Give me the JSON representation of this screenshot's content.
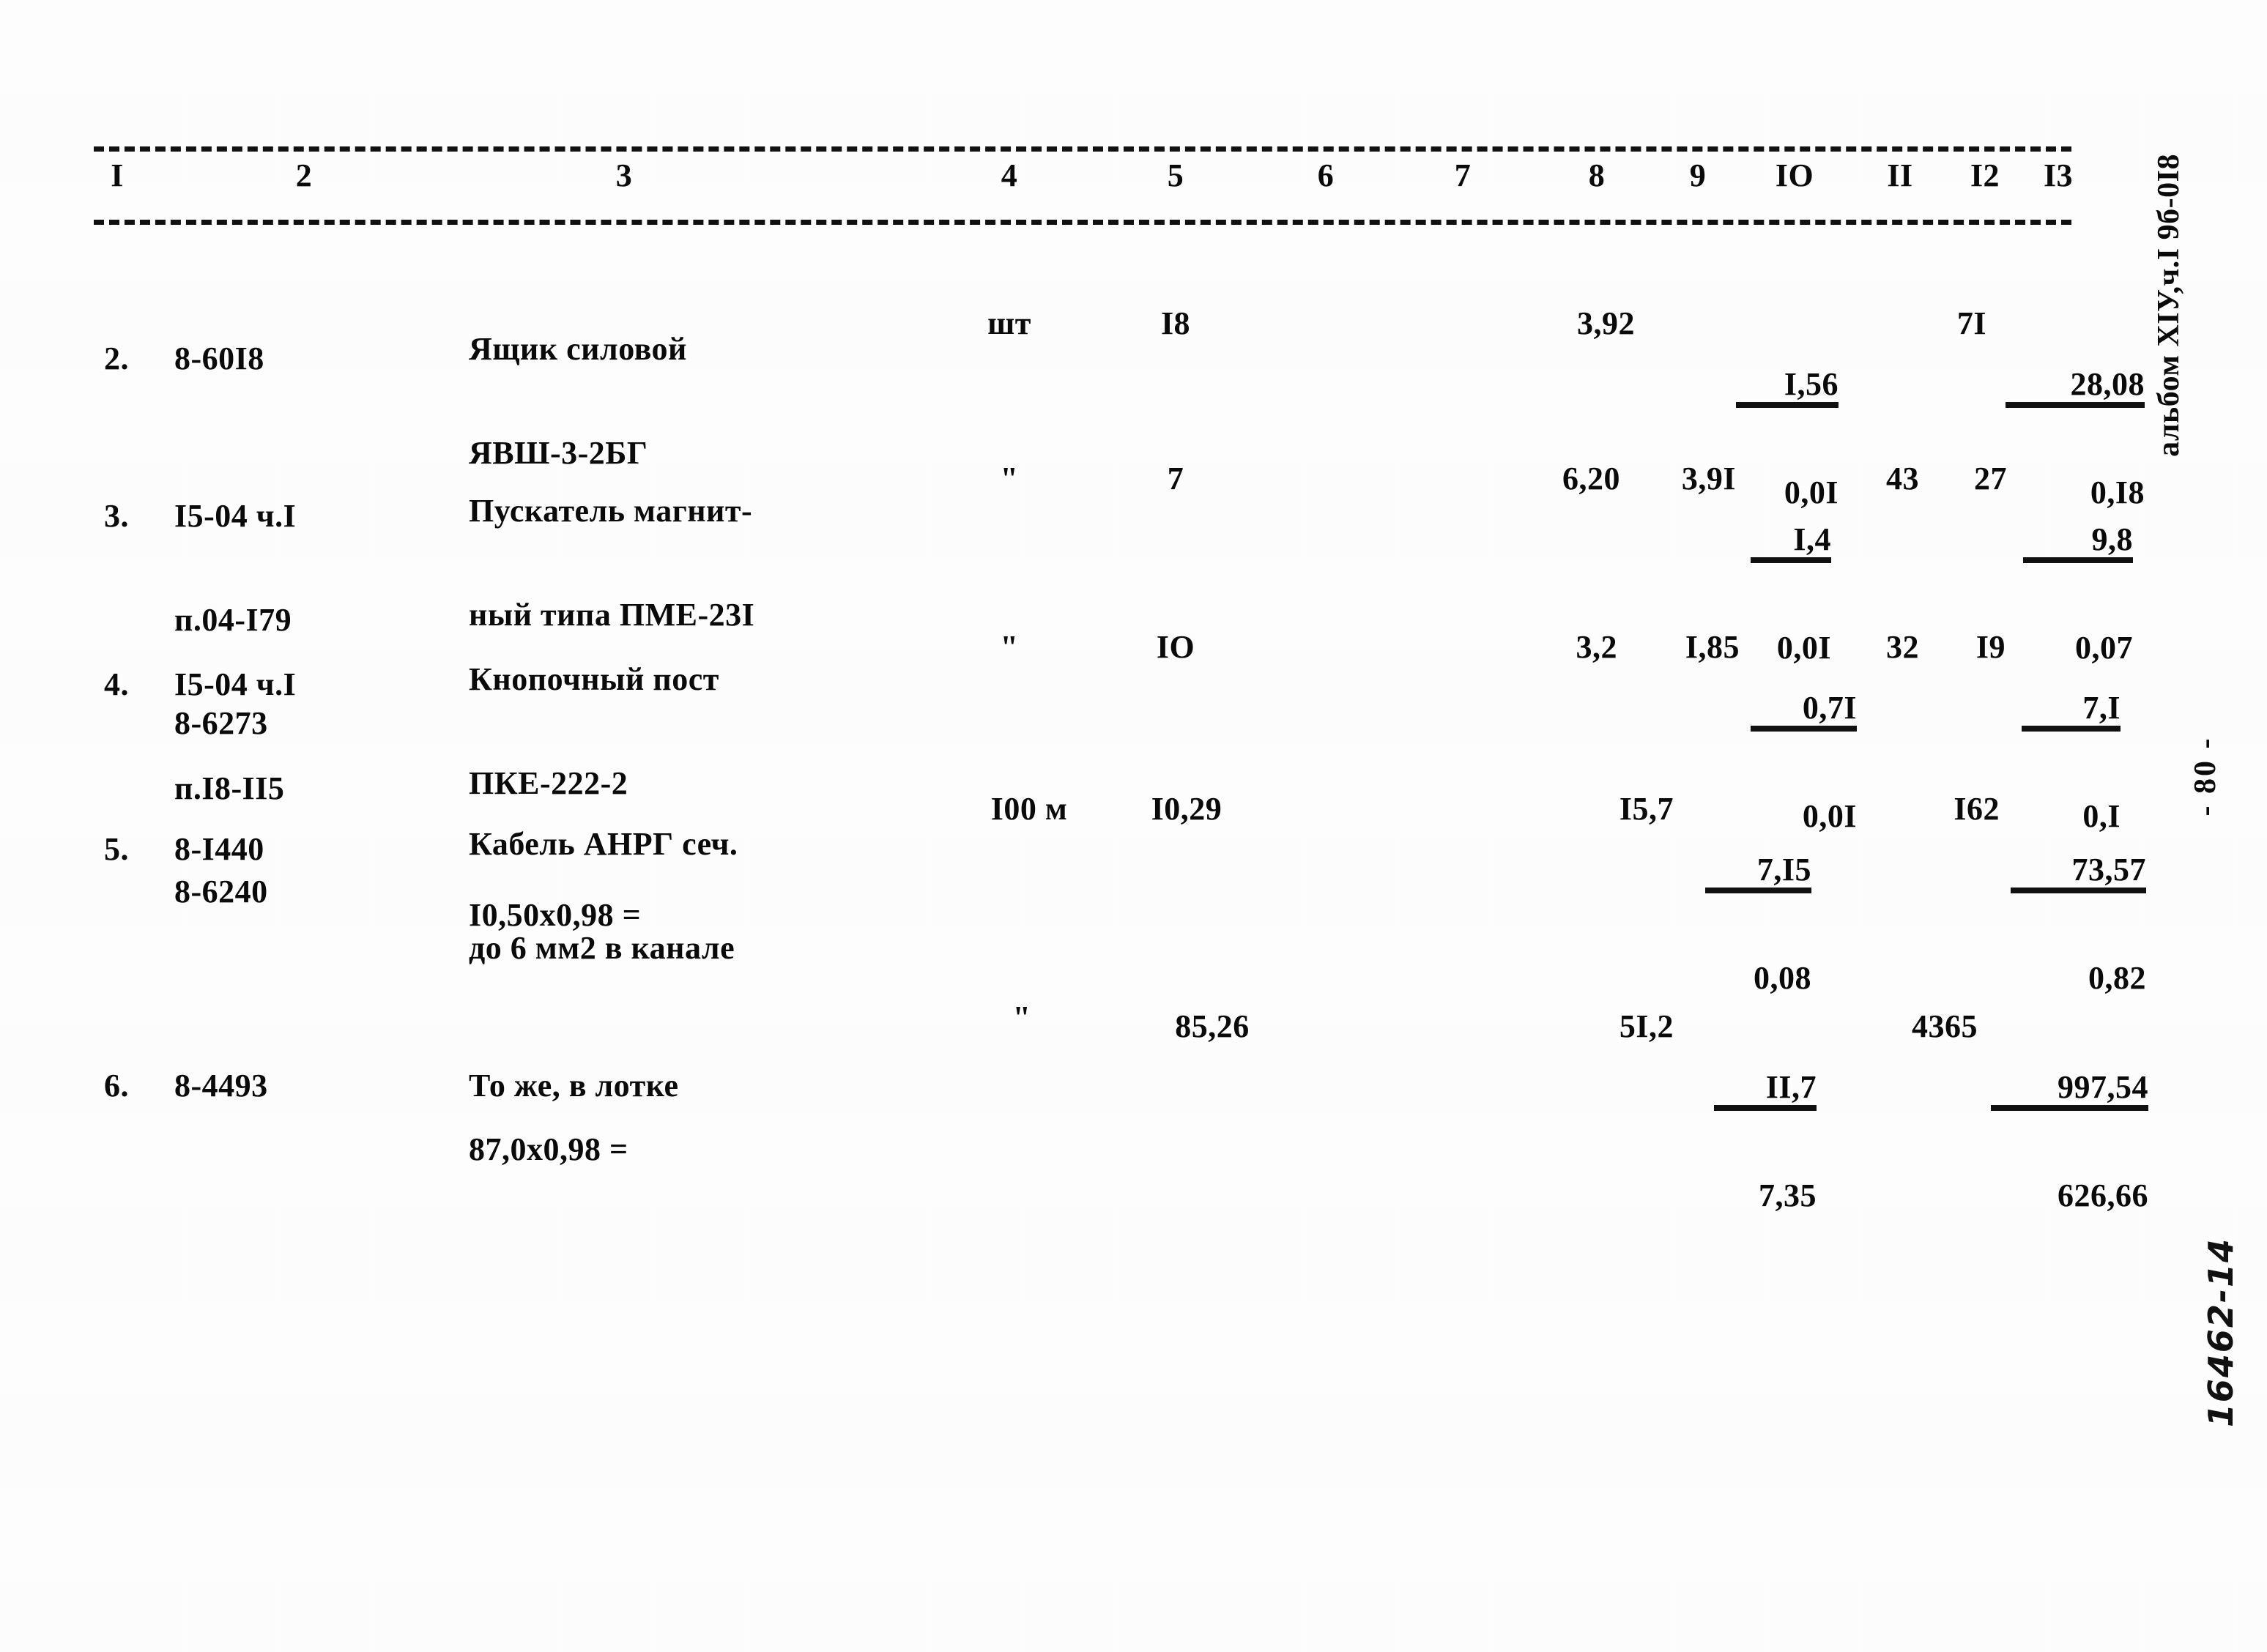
{
  "document": {
    "album_mark": "альбом XIУ,ч.I 9б-0I8",
    "page_number": "- 80 -",
    "handwritten_id": "16462-14"
  },
  "table": {
    "column_headers": [
      "I",
      "2",
      "3",
      "4",
      "5",
      "6",
      "7",
      "8",
      "9",
      "IO",
      "II",
      "I2",
      "I3"
    ],
    "rows": [
      {
        "no": "2.",
        "code": [
          "8-60I8"
        ],
        "name": [
          "Ящик силовой",
          "ЯВШ-3-2БГ"
        ],
        "unit": "шт",
        "qty": "I8",
        "c6": "",
        "c7": "",
        "c8": "3,92",
        "c9": "",
        "c10_num": "I,56",
        "c10_den": "0,0I",
        "c11": "",
        "c12": "7I",
        "c13_num": "28,08",
        "c13_den": "0,I8",
        "formula": ""
      },
      {
        "no": "3.",
        "code": [
          "I5-04 ч.I",
          "п.04-I79",
          "8-6273"
        ],
        "name": [
          "Пускатель магнит-",
          "ный типа ПМЕ-23I"
        ],
        "unit": "\"",
        "qty": "7",
        "c6": "",
        "c7": "",
        "c8": "6,20",
        "c9": "3,9I",
        "c10_num": "I,4",
        "c10_den": "0,0I",
        "c11": "43",
        "c12": "27",
        "c13_num": "9,8",
        "c13_den": "0,07",
        "formula": ""
      },
      {
        "no": "4.",
        "code": [
          "I5-04 ч.I",
          "п.I8-II5",
          "8-6240"
        ],
        "name": [
          "Кнопочный пост",
          "ПКЕ-222-2"
        ],
        "unit": "\"",
        "qty": "IO",
        "c6": "",
        "c7": "",
        "c8": "3,2",
        "c9": "I,85",
        "c10_num": "0,7I",
        "c10_den": "0,0I",
        "c11": "32",
        "c12": "I9",
        "c13_num": "7,I",
        "c13_den": "0,I",
        "formula": ""
      },
      {
        "no": "5.",
        "code": [
          "8-I440"
        ],
        "name": [
          "Кабель АНРГ сеч.",
          "до 6 мм2 в канале"
        ],
        "unit": "I00 м",
        "qty": "I0,29",
        "c6": "",
        "c7": "",
        "c8": "I5,7",
        "c9": "",
        "c10_num": "7,I5",
        "c10_den": "0,08",
        "c11": "",
        "c12": "I62",
        "c13_num": "73,57",
        "c13_den": "0,82",
        "formula": "I0,50x0,98 ="
      },
      {
        "no": "6.",
        "code": [
          "8-4493"
        ],
        "name": [
          "То же, в лотке"
        ],
        "unit": "\"",
        "qty": "85,26",
        "c6": "",
        "c7": "",
        "c8": "5I,2",
        "c9": "",
        "c10_num": "II,7",
        "c10_den": "7,35",
        "c11": "",
        "c12": "4365",
        "c13_num": "997,54",
        "c13_den": "626,66",
        "formula": "87,0x0,98 ="
      }
    ]
  }
}
